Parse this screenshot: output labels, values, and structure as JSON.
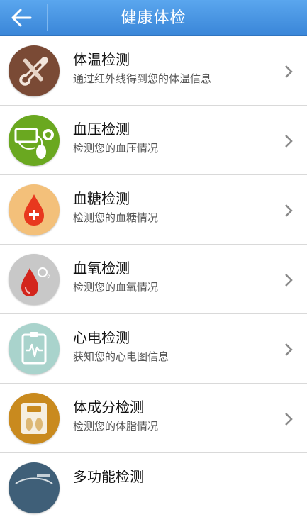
{
  "header": {
    "title": "健康体检"
  },
  "items": [
    {
      "title": "体温检测",
      "subtitle": "通过红外线得到您的体温信息",
      "icon": "thermometer-icon",
      "color": "#7a4a35"
    },
    {
      "title": "血压检测",
      "subtitle": "检测您的血压情况",
      "icon": "blood-pressure-icon",
      "color": "#6aa820"
    },
    {
      "title": "血糖检测",
      "subtitle": "检测您的血糖情况",
      "icon": "blood-drop-icon",
      "color": "#f3c07a"
    },
    {
      "title": "血氧检测",
      "subtitle": "检测您的血氧情况",
      "icon": "oxygen-drop-icon",
      "color": "#c8c8c8"
    },
    {
      "title": "心电检测",
      "subtitle": "获知您的心电图信息",
      "icon": "ecg-icon",
      "color": "#a9d3cc"
    },
    {
      "title": "体成分检测",
      "subtitle": "检测您的体脂情况",
      "icon": "body-scale-icon",
      "color": "#c98a1e"
    },
    {
      "title": "多功能检测",
      "subtitle": "",
      "icon": "multi-function-icon",
      "color": "#3f5f78"
    }
  ]
}
